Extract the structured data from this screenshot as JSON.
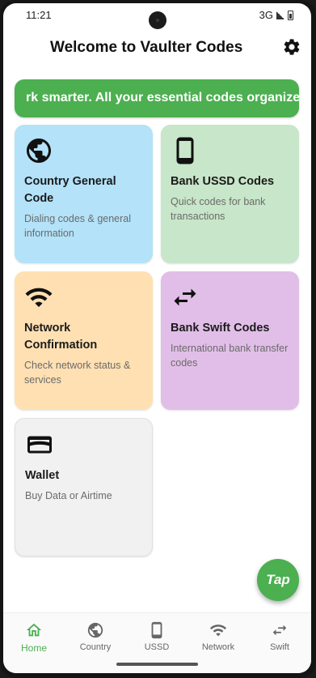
{
  "status_bar": {
    "time": "11:21",
    "network": "3G"
  },
  "header": {
    "title": "Welcome to Vaulter Codes",
    "settings_icon": "settings-icon"
  },
  "marquee": {
    "text": "rk smarter. All your essential codes organized i"
  },
  "cards": [
    {
      "title": "Country General Code",
      "description": "Dialing codes & general information",
      "icon": "globe-icon",
      "color": "#b3e2f9"
    },
    {
      "title": "Bank USSD Codes",
      "description": "Quick codes for bank transactions",
      "icon": "phone-icon",
      "color": "#c8e6c9"
    },
    {
      "title": "Network Confirmation",
      "description": "Check network status & services",
      "icon": "wifi-icon",
      "color": "#ffe0b2"
    },
    {
      "title": "Bank Swift Codes",
      "description": "International bank transfer codes",
      "icon": "swap-icon",
      "color": "#e1bee7"
    },
    {
      "title": "Wallet",
      "description": "Buy Data or Airtime",
      "icon": "wallet-icon",
      "color": "#f1f1f1"
    }
  ],
  "fab": {
    "label": "Tap",
    "color": "#4caf50"
  },
  "bottom_nav": {
    "items": [
      {
        "label": "Home",
        "icon": "home-icon",
        "active": true
      },
      {
        "label": "Country",
        "icon": "globe-icon",
        "active": false
      },
      {
        "label": "USSD",
        "icon": "phone-icon",
        "active": false
      },
      {
        "label": "Network",
        "icon": "wifi-icon",
        "active": false
      },
      {
        "label": "Swift",
        "icon": "swap-icon",
        "active": false
      }
    ]
  },
  "colors": {
    "accent": "#4caf50"
  }
}
